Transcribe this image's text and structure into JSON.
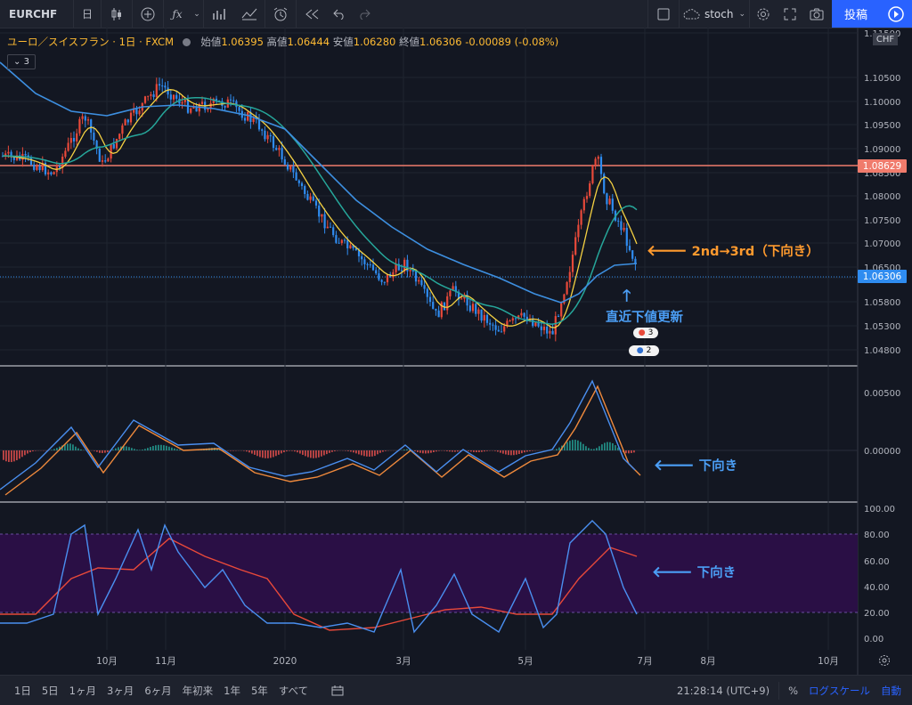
{
  "toolbar": {
    "symbol": "EURCHF",
    "interval": "日",
    "compare_icon": "plus-circle-icon",
    "indicators_icon": "fx-icon",
    "style_icon": "candles-icon",
    "alert_icon": "alarm-icon",
    "replay_icon": "rewind-icon",
    "undo_icon": "undo-icon",
    "redo_icon": "redo-icon",
    "layout_name": "stoch",
    "publish_label": "投稿"
  },
  "legend": {
    "title": "ユーロ／スイスフラン · 1日 · FXCM",
    "open_label": "始値",
    "open": "1.06395",
    "high_label": "高値",
    "high": "1.06444",
    "low_label": "安値",
    "low": "1.06280",
    "close_label": "終値",
    "close": "1.06306",
    "change": "-0.00089 (-0.08%)",
    "collapse_count": "3"
  },
  "price_axis": {
    "currency": "CHF",
    "ticks": [
      "1.11500",
      "1.10500",
      "1.10000",
      "1.09500",
      "1.09000",
      "1.08500",
      "1.08000",
      "1.07500",
      "1.07000",
      "1.06500",
      "1.06000",
      "1.05800",
      "1.05300",
      "1.04800"
    ],
    "hline_value": "1.08629",
    "last_price": "1.06306"
  },
  "macd_axis": {
    "ticks": [
      "0.00500",
      "0.00000"
    ]
  },
  "stoch_axis": {
    "ticks": [
      "100.00",
      "80.00",
      "60.00",
      "40.00",
      "20.00",
      "0.00"
    ]
  },
  "time_axis": {
    "ticks": [
      "10月",
      "11月",
      "2020",
      "3月",
      "5月",
      "7月",
      "8月",
      "10月"
    ]
  },
  "annotations": {
    "price_arrow_text": "2nd→3rd（下向き）",
    "price_up_text": "直近下値更新",
    "macd_text": "下向き",
    "stoch_text": "下向き",
    "event_badge_1": "3",
    "event_badge_2": "2"
  },
  "bottom": {
    "ranges": [
      "1日",
      "5日",
      "1ヶ月",
      "3ヶ月",
      "6ヶ月",
      "年初来",
      "1年",
      "5年",
      "すべて"
    ],
    "time": "21:28:14 (UTC+9)",
    "percent": "%",
    "log_scale": "ログスケール",
    "auto": "自動"
  },
  "colors": {
    "background": "#131722",
    "up_candle": "#e8493a",
    "down_candle": "#2f8cf0",
    "ma_short": "#f5d142",
    "ma_mid": "#26a69a",
    "ma_long": "#3d8fe0",
    "hline": "#f07b6c",
    "macd_line": "#4a8ff0",
    "signal_line": "#f08a3c",
    "stoch_band": "#2a0f45",
    "annotation_orange": "#ff9a2e",
    "annotation_blue": "#4b9ef5",
    "accent": "#2962ff"
  }
}
